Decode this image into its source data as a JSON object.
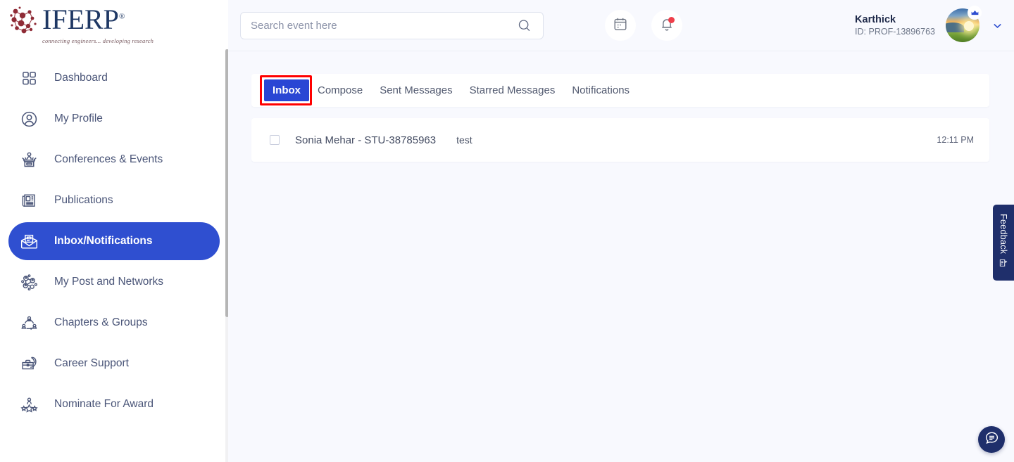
{
  "brand": {
    "name": "IFERP",
    "registered_mark": "®",
    "tagline": "connecting engineers... developing research",
    "logo_icon": "network-nodes-icon",
    "primary_color": "#2f4fd0",
    "logo_text_color": "#1f3864"
  },
  "sidebar": {
    "scrollbar_present": true,
    "items": [
      {
        "label": "Dashboard",
        "icon": "grid-squares-icon",
        "active": false
      },
      {
        "label": "My Profile",
        "icon": "user-circle-icon",
        "active": false
      },
      {
        "label": "Conferences & Events",
        "icon": "podium-speaker-icon",
        "active": false
      },
      {
        "label": "Publications",
        "icon": "newspaper-icon",
        "active": false
      },
      {
        "label": "Inbox/Notifications",
        "icon": "open-envelope-icon",
        "active": true
      },
      {
        "label": "My Post and Networks",
        "icon": "network-people-icon",
        "active": false
      },
      {
        "label": "Chapters & Groups",
        "icon": "group-connections-icon",
        "active": false
      },
      {
        "label": "Career Support",
        "icon": "briefcase-icon",
        "active": false
      },
      {
        "label": "Nominate For Award",
        "icon": "award-stars-icon",
        "active": false
      }
    ]
  },
  "header": {
    "search": {
      "placeholder": "Search event here",
      "value": "",
      "icon": "search-icon"
    },
    "calendar_icon": "calendar-icon",
    "notification_icon": "bell-icon",
    "notification_dot": true,
    "user": {
      "name": "Karthick",
      "id_label": "ID: PROF-13896763",
      "avatar_icon": "avatar-image",
      "badge_icon": "crown-icon",
      "dropdown_icon": "chevron-down-icon"
    }
  },
  "main": {
    "tabs": [
      {
        "label": "Inbox",
        "active": true,
        "highlighted": true
      },
      {
        "label": "Compose",
        "active": false,
        "highlighted": false
      },
      {
        "label": "Sent Messages",
        "active": false,
        "highlighted": false
      },
      {
        "label": "Starred Messages",
        "active": false,
        "highlighted": false
      },
      {
        "label": "Notifications",
        "active": false,
        "highlighted": false
      }
    ],
    "messages": [
      {
        "checked": false,
        "sender": "Sonia Mehar - STU-38785963",
        "subject": "test",
        "time": "12:11 PM"
      }
    ]
  },
  "floating": {
    "feedback_label": "Feedback",
    "feedback_icon": "feedback-form-icon",
    "chat_icon": "chat-bubble-icon",
    "accent_color": "#1f2f6b"
  }
}
